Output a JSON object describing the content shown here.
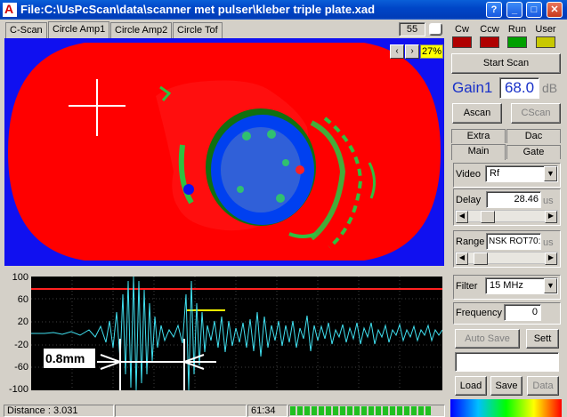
{
  "window": {
    "title": "File:C:\\UsPcScan\\data\\scanner met pulser\\kleber triple plate.xad",
    "buttons": {
      "help": "?",
      "minimize": "_",
      "maximize": "□",
      "close": "✕"
    }
  },
  "tabs": [
    "C-Scan",
    "Circle Amp1",
    "Circle Amp2",
    "Circle Tof"
  ],
  "active_tab": "Circle Amp1",
  "scan_counter": "55",
  "zoom_label": "27%",
  "ascan": {
    "y_ticks": [
      "100",
      "60",
      "20",
      "-20",
      "-60",
      "-100"
    ],
    "measurement_label": "0.8mm"
  },
  "status": {
    "distance": "Distance : 3.031",
    "time": "61:34",
    "progress_segments": 20
  },
  "indicators": [
    {
      "label": "Cw",
      "color": "#b00000"
    },
    {
      "label": "Ccw",
      "color": "#b00000"
    },
    {
      "label": "Run",
      "color": "#00a000"
    },
    {
      "label": "User",
      "color": "#c8c800"
    }
  ],
  "controls": {
    "start_scan": "Start Scan",
    "gain_label": "Gain1",
    "gain_value": "68.0",
    "gain_unit": "dB",
    "ascan_button": "Ascan",
    "cscan_button": "CScan",
    "side_tabs_top": [
      "Extra",
      "Dac"
    ],
    "side_tabs_bottom": [
      "Main",
      "Gate"
    ],
    "video_label": "Video",
    "video_value": "Rf",
    "delay_label": "Delay",
    "delay_value": "28.46",
    "delay_unit": "us",
    "range_label": "Range",
    "range_value": "NSK ROT70:",
    "range_unit": "us",
    "filter_label": "Filter",
    "filter_value": "15 MHz",
    "frequency_label": "Frequency",
    "frequency_value": "0",
    "auto_save": "Auto Save",
    "sett": "Sett",
    "load": "Load",
    "save": "Save",
    "data": "Data"
  }
}
